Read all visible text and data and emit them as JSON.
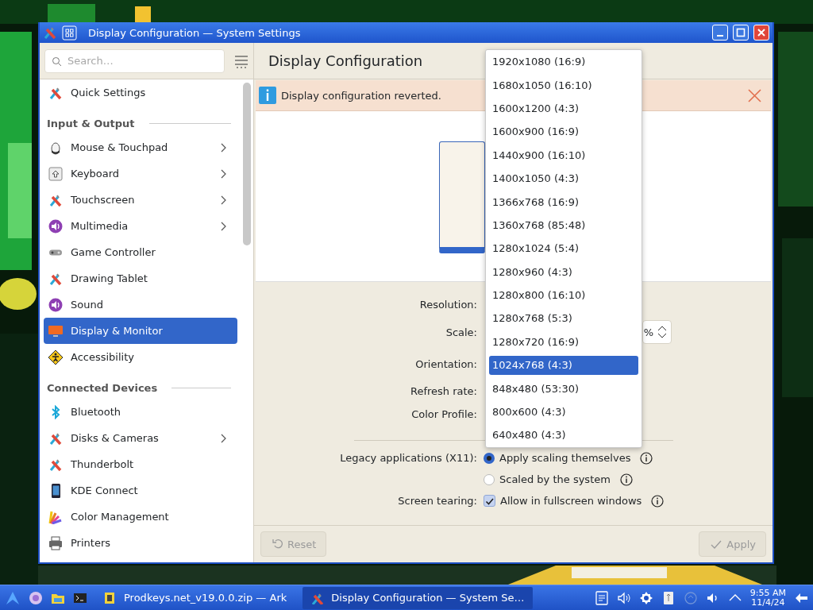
{
  "window": {
    "title": "Display Configuration — System Settings"
  },
  "sidebar": {
    "search": {
      "placeholder": "Search…"
    },
    "items": [
      {
        "kind": "item",
        "label": "Quick Settings",
        "has_children": false,
        "selected": false
      },
      {
        "kind": "header",
        "label": "Input & Output"
      },
      {
        "kind": "item",
        "label": "Mouse & Touchpad",
        "has_children": true,
        "selected": false
      },
      {
        "kind": "item",
        "label": "Keyboard",
        "has_children": true,
        "selected": false
      },
      {
        "kind": "item",
        "label": "Touchscreen",
        "has_children": true,
        "selected": false
      },
      {
        "kind": "item",
        "label": "Multimedia",
        "has_children": true,
        "selected": false
      },
      {
        "kind": "item",
        "label": "Game Controller",
        "has_children": false,
        "selected": false
      },
      {
        "kind": "item",
        "label": "Drawing Tablet",
        "has_children": false,
        "selected": false
      },
      {
        "kind": "item",
        "label": "Sound",
        "has_children": false,
        "selected": false
      },
      {
        "kind": "item",
        "label": "Display & Monitor",
        "has_children": false,
        "selected": true
      },
      {
        "kind": "item",
        "label": "Accessibility",
        "has_children": false,
        "selected": false
      },
      {
        "kind": "header",
        "label": "Connected Devices"
      },
      {
        "kind": "item",
        "label": "Bluetooth",
        "has_children": false,
        "selected": false
      },
      {
        "kind": "item",
        "label": "Disks & Cameras",
        "has_children": true,
        "selected": false
      },
      {
        "kind": "item",
        "label": "Thunderbolt",
        "has_children": false,
        "selected": false
      },
      {
        "kind": "item",
        "label": "KDE Connect",
        "has_children": false,
        "selected": false
      },
      {
        "kind": "item",
        "label": "Color Management",
        "has_children": false,
        "selected": false
      },
      {
        "kind": "item",
        "label": "Printers",
        "has_children": false,
        "selected": false
      }
    ]
  },
  "page": {
    "title": "Display Configuration"
  },
  "notification": {
    "message": "Display configuration reverted."
  },
  "settings": {
    "rows": [
      {
        "kind": "label",
        "label": "Resolution:"
      },
      {
        "kind": "spinbox",
        "label": "Scale:",
        "value": "%"
      },
      {
        "kind": "label",
        "label": "Orientation:"
      },
      {
        "kind": "label",
        "label": "Refresh rate:"
      },
      {
        "kind": "label",
        "label": "Color Profile:"
      },
      {
        "kind": "separator"
      },
      {
        "kind": "radio",
        "label": "Legacy applications (X11):",
        "options": [
          {
            "label": "Apply scaling themselves",
            "selected": true
          },
          {
            "label": "Scaled by the system",
            "selected": false
          }
        ]
      },
      {
        "kind": "checkbox",
        "label": "Screen tearing:",
        "text": "Allow in fullscreen windows",
        "checked": true
      }
    ]
  },
  "resolution_menu": {
    "options": [
      {
        "label": "1920x1080 (16:9)",
        "selected": false
      },
      {
        "label": "1680x1050 (16:10)",
        "selected": false
      },
      {
        "label": "1600x1200 (4:3)",
        "selected": false
      },
      {
        "label": "1600x900 (16:9)",
        "selected": false
      },
      {
        "label": "1440x900 (16:10)",
        "selected": false
      },
      {
        "label": "1400x1050 (4:3)",
        "selected": false
      },
      {
        "label": "1366x768 (16:9)",
        "selected": false
      },
      {
        "label": "1360x768 (85:48)",
        "selected": false
      },
      {
        "label": "1280x1024 (5:4)",
        "selected": false
      },
      {
        "label": "1280x960 (4:3)",
        "selected": false
      },
      {
        "label": "1280x800 (16:10)",
        "selected": false
      },
      {
        "label": "1280x768 (5:3)",
        "selected": false
      },
      {
        "label": "1280x720 (16:9)",
        "selected": false
      },
      {
        "label": "1024x768 (4:3)",
        "selected": true
      },
      {
        "label": "848x480 (53:30)",
        "selected": false
      },
      {
        "label": "800x600 (4:3)",
        "selected": false
      },
      {
        "label": "640x480 (4:3)",
        "selected": false
      }
    ]
  },
  "footer": {
    "buttons": [
      {
        "kind": "reset",
        "label": "Reset",
        "disabled": true
      },
      {
        "kind": "apply",
        "label": "Apply",
        "disabled": true
      }
    ]
  },
  "taskbar": {
    "tasks": [
      {
        "label": "Prodkeys.net_v19.0.0.zip — Ark",
        "selected": false
      },
      {
        "label": "Display Configuration — System Se…",
        "selected": true
      }
    ],
    "clock": {
      "time": "9:55 AM",
      "date": "11/4/24"
    }
  }
}
